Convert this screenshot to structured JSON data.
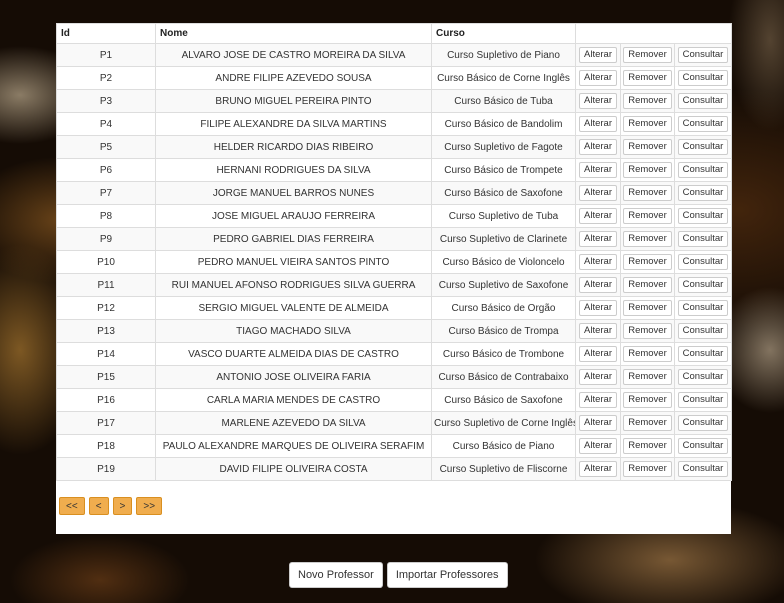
{
  "table": {
    "headers": {
      "id": "Id",
      "nome": "Nome",
      "curso": "Curso"
    },
    "actions": {
      "alterar": "Alterar",
      "remover": "Remover",
      "consultar": "Consultar"
    },
    "rows": [
      {
        "id": "P1",
        "nome": "ALVARO JOSE DE CASTRO MOREIRA DA SILVA",
        "curso": "Curso Supletivo de Piano"
      },
      {
        "id": "P2",
        "nome": "ANDRE FILIPE AZEVEDO SOUSA",
        "curso": "Curso Básico de Corne Inglês"
      },
      {
        "id": "P3",
        "nome": "BRUNO MIGUEL PEREIRA PINTO",
        "curso": "Curso Básico de Tuba"
      },
      {
        "id": "P4",
        "nome": "FILIPE ALEXANDRE DA SILVA MARTINS",
        "curso": "Curso Básico de Bandolim"
      },
      {
        "id": "P5",
        "nome": "HELDER RICARDO DIAS RIBEIRO",
        "curso": "Curso Supletivo de Fagote"
      },
      {
        "id": "P6",
        "nome": "HERNANI RODRIGUES DA SILVA",
        "curso": "Curso Básico de Trompete"
      },
      {
        "id": "P7",
        "nome": "JORGE MANUEL BARROS NUNES",
        "curso": "Curso Básico de Saxofone"
      },
      {
        "id": "P8",
        "nome": "JOSE MIGUEL ARAUJO FERREIRA",
        "curso": "Curso Supletivo de Tuba"
      },
      {
        "id": "P9",
        "nome": "PEDRO GABRIEL DIAS FERREIRA",
        "curso": "Curso Supletivo de Clarinete"
      },
      {
        "id": "P10",
        "nome": "PEDRO MANUEL VIEIRA SANTOS PINTO",
        "curso": "Curso Básico de Violoncelo"
      },
      {
        "id": "P11",
        "nome": "RUI MANUEL AFONSO RODRIGUES SILVA GUERRA",
        "curso": "Curso Supletivo de Saxofone"
      },
      {
        "id": "P12",
        "nome": "SERGIO MIGUEL VALENTE DE ALMEIDA",
        "curso": "Curso Básico de Orgão"
      },
      {
        "id": "P13",
        "nome": "TIAGO MACHADO SILVA",
        "curso": "Curso Básico de Trompa"
      },
      {
        "id": "P14",
        "nome": "VASCO DUARTE ALMEIDA DIAS DE CASTRO",
        "curso": "Curso Básico de Trombone"
      },
      {
        "id": "P15",
        "nome": "ANTONIO JOSE OLIVEIRA FARIA",
        "curso": "Curso Básico de Contrabaixo"
      },
      {
        "id": "P16",
        "nome": "CARLA MARIA MENDES DE CASTRO",
        "curso": "Curso Básico de Saxofone"
      },
      {
        "id": "P17",
        "nome": "MARLENE AZEVEDO DA SILVA",
        "curso": "Curso Supletivo de Corne Inglês"
      },
      {
        "id": "P18",
        "nome": "PAULO ALEXANDRE MARQUES DE OLIVEIRA SERAFIM",
        "curso": "Curso Básico de Piano"
      },
      {
        "id": "P19",
        "nome": "DAVID FILIPE OLIVEIRA COSTA",
        "curso": "Curso Supletivo de Fliscorne"
      }
    ]
  },
  "pagination": {
    "first": "<<",
    "prev": "<",
    "next": ">",
    "last": ">>"
  },
  "actions": {
    "novo": "Novo Professor",
    "importar": "Importar Professores"
  },
  "colors": {
    "pager_accent": "#f0ad4e",
    "panel_bg": "#ffffff"
  }
}
